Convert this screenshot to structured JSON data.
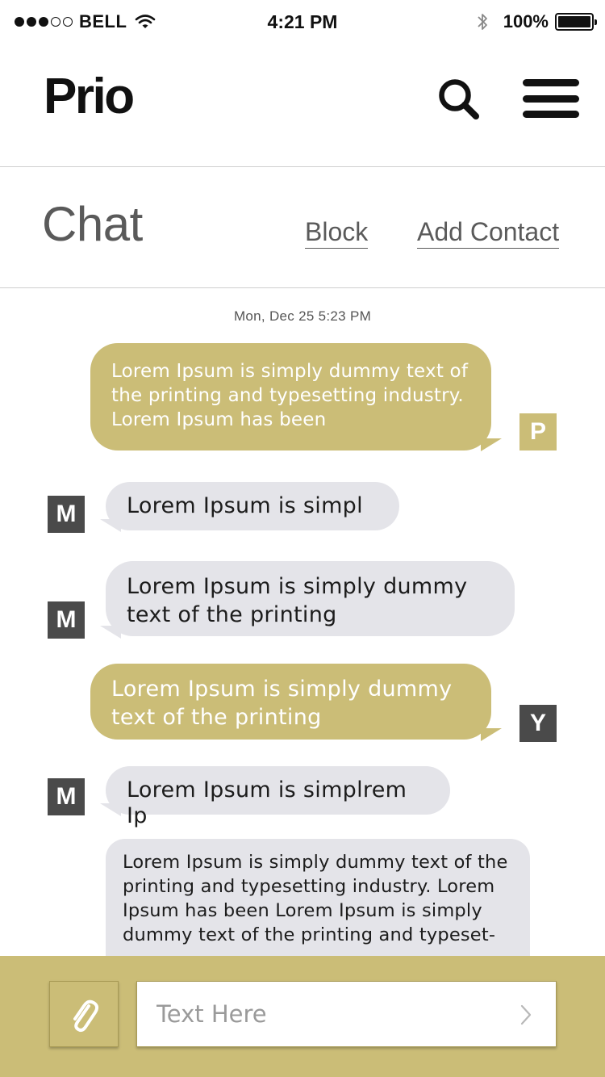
{
  "status_bar": {
    "carrier": "BELL",
    "time": "4:21 PM",
    "battery": "100%",
    "signal_bars": 3,
    "signal_total": 5,
    "icons": [
      "signal-dots-icon",
      "wifi-icon",
      "bluetooth-icon",
      "battery-icon"
    ]
  },
  "header": {
    "logo": "Prio",
    "search_icon": "search-icon",
    "menu_icon": "hamburger-menu-icon"
  },
  "chat_header": {
    "title": "Chat",
    "block_label": "Block",
    "add_contact_label": "Add Contact"
  },
  "chat": {
    "timestamp": "Mon, Dec 25 5:23 PM",
    "messages": [
      {
        "direction": "outgoing",
        "avatar": "P",
        "lines": [
          "Lorem Ipsum is simply dummy text of",
          "the printing and typesetting industry.",
          "Lorem Ipsum has been"
        ]
      },
      {
        "direction": "incoming",
        "avatar": "M",
        "lines": [
          "Lorem Ipsum is simpl"
        ]
      },
      {
        "direction": "incoming",
        "avatar": "M",
        "lines": [
          "Lorem Ipsum is simply dummy",
          "text of the printing"
        ]
      },
      {
        "direction": "outgoing",
        "avatar": "Y",
        "lines": [
          "Lorem Ipsum is simply dummy",
          "text of the printing"
        ]
      },
      {
        "direction": "incoming",
        "avatar": "M",
        "lines": [
          "Lorem Ipsum is simplrem Ip"
        ]
      },
      {
        "direction": "incoming",
        "avatar": "",
        "lines": [
          "Lorem Ipsum is simply dummy text of the",
          "printing and typesetting industry. Lorem",
          "Ipsum has been Lorem Ipsum is simply",
          "dummy text of the printing and typeset-"
        ]
      }
    ]
  },
  "composer": {
    "placeholder": "Text Here",
    "attach_icon": "paperclip-icon",
    "send_icon": "chevron-right-icon"
  },
  "colors": {
    "accent_gold": "#cbbd77",
    "incoming_bubble": "#e4e4e9",
    "avatar_dark": "#4a4a4a"
  }
}
